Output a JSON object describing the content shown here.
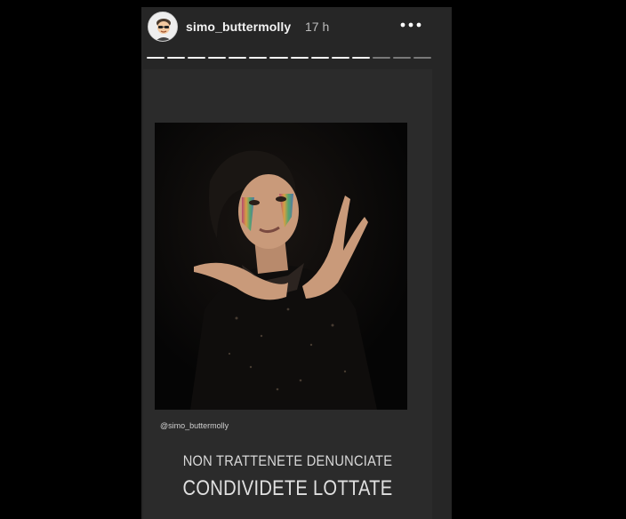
{
  "story": {
    "username": "simo_buttermolly",
    "time": "17 h",
    "more_icon": "more-horizontal-icon",
    "progress_total": 14,
    "progress_done": 11
  },
  "content": {
    "photo_credit": "@simo_buttermolly",
    "caption_line1": "NON TRATTENETE  DENUNCIATE",
    "caption_line2": "CONDIVIDETE LOTTATE"
  },
  "colors": {
    "page_bg": "#000000",
    "story_bg": "#262626",
    "card_bg": "#2b2b2b",
    "text": "#f2f2f2"
  }
}
